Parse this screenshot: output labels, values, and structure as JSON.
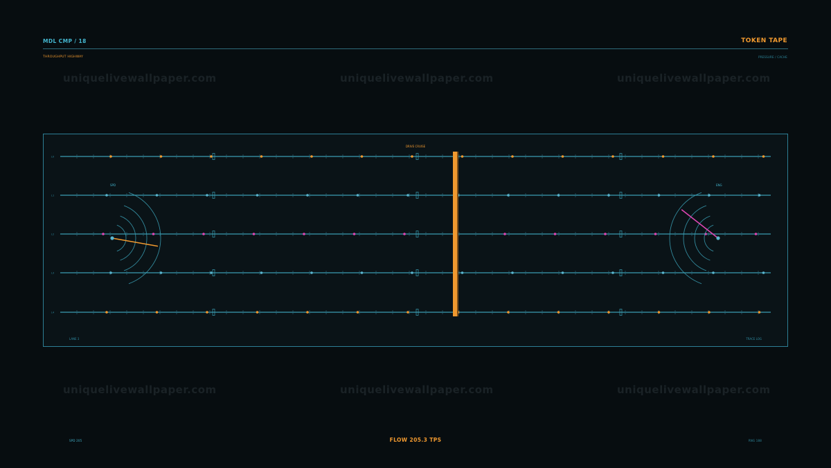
{
  "header": {
    "title_left": "MDL CMP / 18",
    "title_right": "TOKEN TAPE",
    "subtitle_left": "THROUGHPUT HIGHWAY",
    "subtitle_right": "PRESSURE / CACHE"
  },
  "watermark": "uniquelivewallpaper.com",
  "panel": {
    "top_label": "DRIVE CRUISE",
    "corner_bottom_left": "LANE 3",
    "corner_bottom_right": "TRACE LOG",
    "gauge_left_label": "SPD",
    "gauge_right_label": "ENG",
    "lanes": [
      {
        "name": "L0",
        "color": "#f0992f"
      },
      {
        "name": "L1",
        "color": "#5ab6cf"
      },
      {
        "name": "L2",
        "color": "#e046b4"
      },
      {
        "name": "L3",
        "color": "#5ab6cf"
      },
      {
        "name": "L4",
        "color": "#f0992f"
      }
    ],
    "colors": {
      "track": "#3a9db3",
      "marker": "#f0992f",
      "needle_left": "#f0992f",
      "needle_right": "#e046b4",
      "gauge_arc": "#3a9db3"
    }
  },
  "footer": {
    "left": "SPD 205",
    "center": "FLOW  205.3 TPS",
    "right": "RNG 188"
  }
}
